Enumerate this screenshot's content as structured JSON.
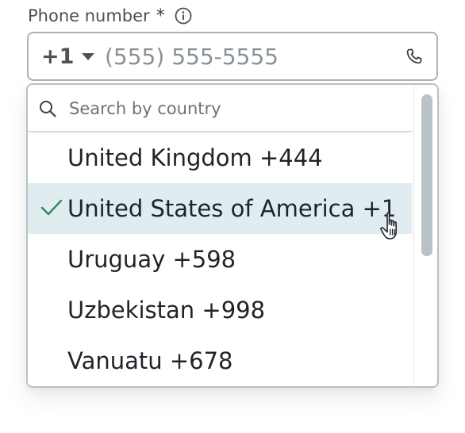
{
  "field": {
    "label": "Phone number",
    "required_marker": "*",
    "info_icon": "info-circle-icon",
    "country_code": "+1",
    "caret_icon": "triangle-down-icon",
    "placeholder": "(555) 555-5555",
    "phone_icon": "phone-icon"
  },
  "dropdown": {
    "search_placeholder": "Search by country",
    "search_icon": "magnifier-icon",
    "options": [
      {
        "label": "United Kingdom +444",
        "selected": false
      },
      {
        "label": "United States of America +1",
        "selected": true
      },
      {
        "label": "Uruguay +598",
        "selected": false
      },
      {
        "label": "Uzbekistan +998",
        "selected": false
      },
      {
        "label": "Vanuatu +678",
        "selected": false
      }
    ],
    "check_icon": "checkmark-icon",
    "selected_color": "#dfecf0",
    "check_color": "#2e8b57"
  },
  "cursor": "hand-pointer-icon"
}
